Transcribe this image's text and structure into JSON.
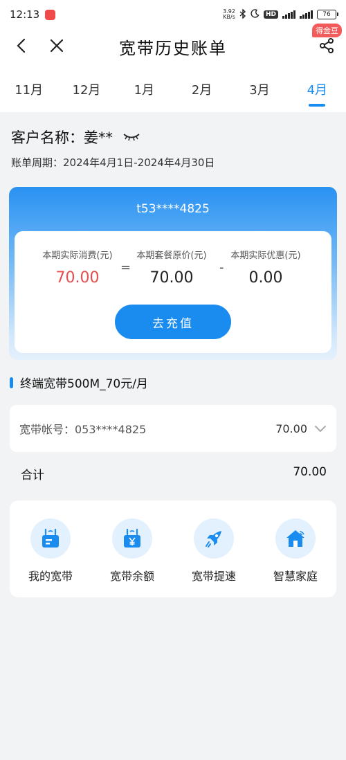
{
  "status_bar": {
    "time": "12:13",
    "net_speed_value": "3.92",
    "net_speed_unit": "KB/s",
    "hd_label": "HD",
    "battery": "76"
  },
  "header": {
    "title": "宽带历史账单",
    "badge": "得金豆"
  },
  "month_tabs": [
    {
      "label": "11月",
      "active": false
    },
    {
      "label": "12月",
      "active": false
    },
    {
      "label": "1月",
      "active": false
    },
    {
      "label": "2月",
      "active": false
    },
    {
      "label": "3月",
      "active": false
    },
    {
      "label": "4月",
      "active": true
    }
  ],
  "customer": {
    "label": "客户名称：",
    "name": "姜**"
  },
  "billing_period": "账单周期：2024年4月1日-2024年4月30日",
  "bill": {
    "account": "t53****4825",
    "actual_label": "本期实际消费(元)",
    "actual_value": "70.00",
    "package_label": "本期套餐原价(元)",
    "package_value": "70.00",
    "discount_label": "本期实际优惠(元)",
    "discount_value": "0.00",
    "equals": "=",
    "minus": "-",
    "recharge_label": "去充值"
  },
  "package": {
    "title": "终端宽带500M_70元/月",
    "account_label": "宽带帐号：053****4825",
    "account_amount": "70.00"
  },
  "total": {
    "label": "合计",
    "value": "70.00"
  },
  "services": [
    {
      "label": "我的宽带",
      "icon": "router-icon"
    },
    {
      "label": "宽带余额",
      "icon": "router-yen-icon"
    },
    {
      "label": "宽带提速",
      "icon": "rocket-icon"
    },
    {
      "label": "智慧家庭",
      "icon": "smart-home-icon"
    }
  ],
  "colors": {
    "accent": "#1a8cf0",
    "amount_red": "#e74c4c",
    "badge_red": "#f25b5b"
  }
}
